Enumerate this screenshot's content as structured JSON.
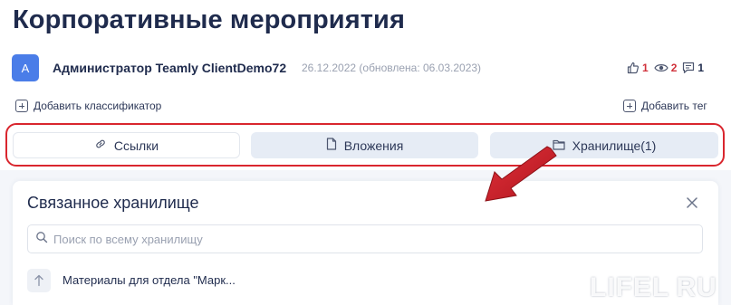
{
  "page": {
    "title": "Корпоративные мероприятия"
  },
  "author": {
    "avatar_letter": "A",
    "name": "Администратор Teamly ClientDemo72",
    "dates": "26.12.2022 (обновлена: 06.03.2023)"
  },
  "stats": {
    "likes": "1",
    "views": "2",
    "comments": "1"
  },
  "actions": {
    "add_classifier": "Добавить классификатор",
    "add_tag": "Добавить тег"
  },
  "tabs": [
    {
      "label": "Ссылки",
      "icon": "link-icon"
    },
    {
      "label": "Вложения",
      "icon": "file-icon"
    },
    {
      "label": "Хранилище",
      "count": "(1)",
      "icon": "folder-icon"
    }
  ],
  "panel": {
    "title": "Связанное хранилище",
    "search_placeholder": "Поиск по всему хранилищу",
    "items": [
      {
        "label": "Материалы для отдела \"Марк..."
      }
    ]
  },
  "watermark": "LIFEL RU",
  "colors": {
    "accent": "#4a7de8",
    "highlight_red": "#d9262e",
    "tab_bg": "#e6ecf5",
    "text_dark": "#1f2b4d"
  }
}
